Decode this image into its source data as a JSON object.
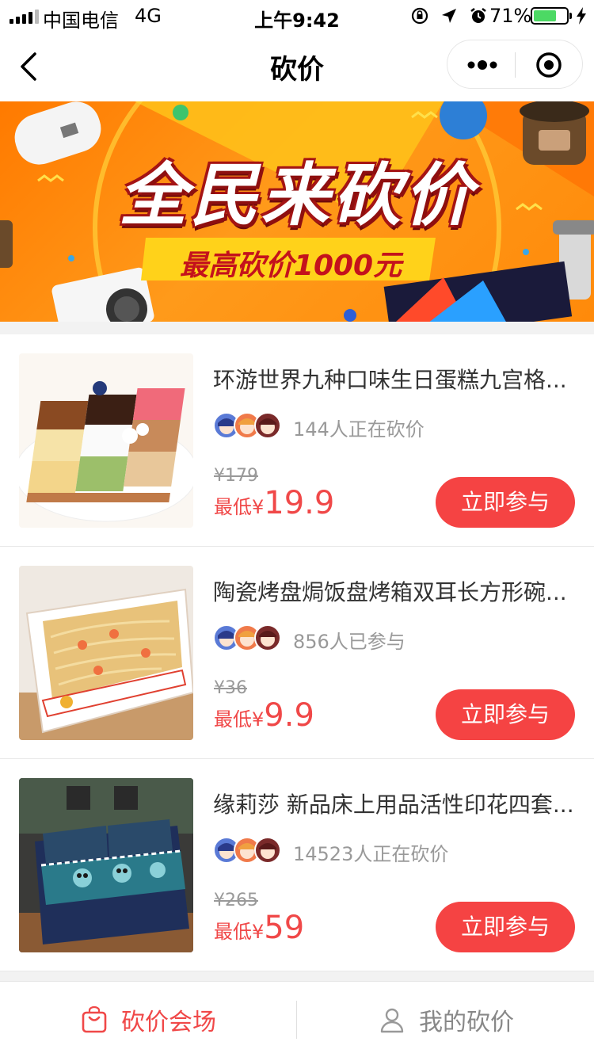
{
  "status_bar": {
    "carrier": "中国电信",
    "network": "4G",
    "time": "上午9:42",
    "battery": "71%",
    "battery_level": 0.71
  },
  "nav": {
    "title": "砍价"
  },
  "banner": {
    "title": "全民来砍价",
    "subtitle": "最高砍价1000元"
  },
  "products": [
    {
      "title": "环游世界九种口味生日蛋糕九宫格...",
      "people": "144人正在砍价",
      "original_price": "¥179",
      "low_label": "最低",
      "currency": "¥",
      "low_price": "19.9",
      "button": "立即参与",
      "image": "cake-image"
    },
    {
      "title": "陶瓷烤盘焗饭盘烤箱双耳长方形碗...",
      "people": "856人已参与",
      "original_price": "¥36",
      "low_label": "最低",
      "currency": "¥",
      "low_price": "9.9",
      "button": "立即参与",
      "image": "baking-dish-image"
    },
    {
      "title": "缘莉莎 新品床上用品活性印花四套...",
      "people": "14523人正在砍价",
      "original_price": "¥265",
      "low_label": "最低",
      "currency": "¥",
      "low_price": "59",
      "button": "立即参与",
      "image": "bedding-image"
    }
  ],
  "tab_bar": {
    "items": [
      {
        "label": "砍价会场",
        "icon": "bag-icon",
        "active": true,
        "color": "#f04848"
      },
      {
        "label": "我的砍价",
        "icon": "user-icon",
        "active": false,
        "color": "#888888"
      }
    ]
  },
  "colors": {
    "accent": "#f54343",
    "price": "#f04848",
    "banner": "#ff8a0a"
  }
}
